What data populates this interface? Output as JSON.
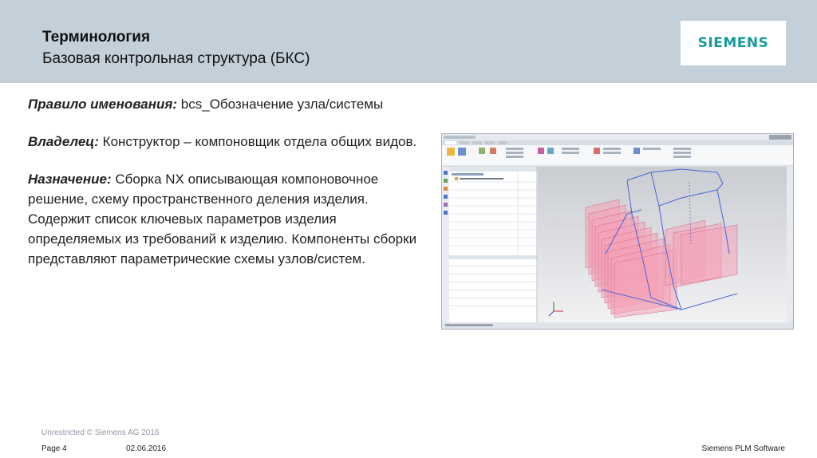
{
  "header": {
    "title": "Терминология",
    "subtitle": "Базовая контрольная структура (БКС)",
    "logo": "SIEMENS"
  },
  "content": {
    "naming_label": "Правило именования:",
    "naming_text": " bcs_Обозначение узла/системы",
    "owner_label": "Владелец:",
    "owner_text": " Конструктор – компоновщик отдела общих видов.",
    "purpose_label": "Назначение:",
    "purpose_text": " Сборка NX описывающая компоновочное решение, схему пространственного деления изделия. Содержит список ключевых параметров изделия определяемых из требований к изделию.  Компоненты сборки представляют параметрические схемы узлов/систем."
  },
  "footer": {
    "classification": "Unrestricted © Siemens AG 2016",
    "page": "Page 4",
    "date": "02.06.2016",
    "company": "Siemens PLM Software"
  },
  "colors": {
    "header_bg": "#c3cfd9",
    "logo_teal": "#159b9b",
    "plane_fill": "#f4a3b8",
    "wire": "#4a63d8"
  }
}
